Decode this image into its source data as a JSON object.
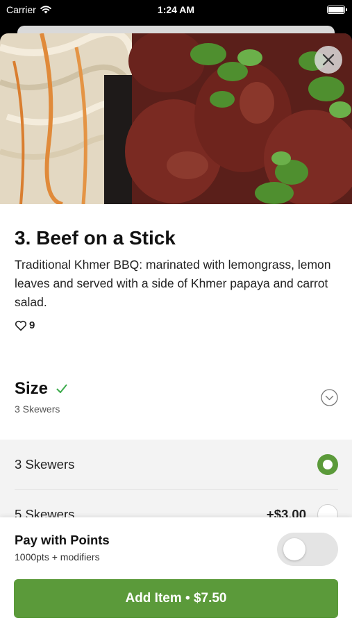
{
  "status_bar": {
    "carrier": "Carrier",
    "time": "1:24 AM"
  },
  "item": {
    "title": "3. Beef on a Stick",
    "description": "Traditional Khmer BBQ: marinated with lemongrass, lemon leaves and served with a side of Khmer papaya and carrot salad.",
    "likes": "9"
  },
  "size": {
    "title": "Size",
    "selected": "3 Skewers",
    "options": [
      {
        "label": "3 Skewers",
        "price": "",
        "selected": true
      },
      {
        "label": "5 Skewers",
        "price": "+$3.00",
        "selected": false
      }
    ]
  },
  "pay_with_points": {
    "title": "Pay with Points",
    "subtitle": "1000pts + modifiers",
    "enabled": false
  },
  "add_button": {
    "label": "Add Item • $7.50"
  },
  "colors": {
    "accent_green": "#5b9a3a",
    "check_green": "#3aaa4a"
  },
  "icons": [
    "wifi-icon",
    "battery-icon",
    "close-icon",
    "heart-icon",
    "checkmark-icon",
    "chevron-down-icon"
  ]
}
